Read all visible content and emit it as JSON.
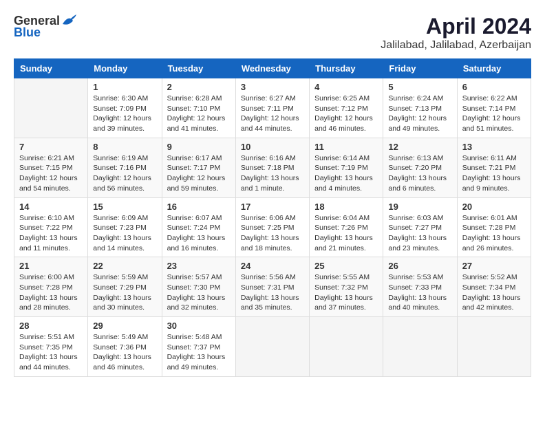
{
  "logo": {
    "text_general": "General",
    "text_blue": "Blue"
  },
  "title": {
    "month": "April 2024",
    "location": "Jalilabad, Jalilabad, Azerbaijan"
  },
  "headers": [
    "Sunday",
    "Monday",
    "Tuesday",
    "Wednesday",
    "Thursday",
    "Friday",
    "Saturday"
  ],
  "weeks": [
    [
      {
        "day": "",
        "info": ""
      },
      {
        "day": "1",
        "info": "Sunrise: 6:30 AM\nSunset: 7:09 PM\nDaylight: 12 hours\nand 39 minutes."
      },
      {
        "day": "2",
        "info": "Sunrise: 6:28 AM\nSunset: 7:10 PM\nDaylight: 12 hours\nand 41 minutes."
      },
      {
        "day": "3",
        "info": "Sunrise: 6:27 AM\nSunset: 7:11 PM\nDaylight: 12 hours\nand 44 minutes."
      },
      {
        "day": "4",
        "info": "Sunrise: 6:25 AM\nSunset: 7:12 PM\nDaylight: 12 hours\nand 46 minutes."
      },
      {
        "day": "5",
        "info": "Sunrise: 6:24 AM\nSunset: 7:13 PM\nDaylight: 12 hours\nand 49 minutes."
      },
      {
        "day": "6",
        "info": "Sunrise: 6:22 AM\nSunset: 7:14 PM\nDaylight: 12 hours\nand 51 minutes."
      }
    ],
    [
      {
        "day": "7",
        "info": "Sunrise: 6:21 AM\nSunset: 7:15 PM\nDaylight: 12 hours\nand 54 minutes."
      },
      {
        "day": "8",
        "info": "Sunrise: 6:19 AM\nSunset: 7:16 PM\nDaylight: 12 hours\nand 56 minutes."
      },
      {
        "day": "9",
        "info": "Sunrise: 6:17 AM\nSunset: 7:17 PM\nDaylight: 12 hours\nand 59 minutes."
      },
      {
        "day": "10",
        "info": "Sunrise: 6:16 AM\nSunset: 7:18 PM\nDaylight: 13 hours\nand 1 minute."
      },
      {
        "day": "11",
        "info": "Sunrise: 6:14 AM\nSunset: 7:19 PM\nDaylight: 13 hours\nand 4 minutes."
      },
      {
        "day": "12",
        "info": "Sunrise: 6:13 AM\nSunset: 7:20 PM\nDaylight: 13 hours\nand 6 minutes."
      },
      {
        "day": "13",
        "info": "Sunrise: 6:11 AM\nSunset: 7:21 PM\nDaylight: 13 hours\nand 9 minutes."
      }
    ],
    [
      {
        "day": "14",
        "info": "Sunrise: 6:10 AM\nSunset: 7:22 PM\nDaylight: 13 hours\nand 11 minutes."
      },
      {
        "day": "15",
        "info": "Sunrise: 6:09 AM\nSunset: 7:23 PM\nDaylight: 13 hours\nand 14 minutes."
      },
      {
        "day": "16",
        "info": "Sunrise: 6:07 AM\nSunset: 7:24 PM\nDaylight: 13 hours\nand 16 minutes."
      },
      {
        "day": "17",
        "info": "Sunrise: 6:06 AM\nSunset: 7:25 PM\nDaylight: 13 hours\nand 18 minutes."
      },
      {
        "day": "18",
        "info": "Sunrise: 6:04 AM\nSunset: 7:26 PM\nDaylight: 13 hours\nand 21 minutes."
      },
      {
        "day": "19",
        "info": "Sunrise: 6:03 AM\nSunset: 7:27 PM\nDaylight: 13 hours\nand 23 minutes."
      },
      {
        "day": "20",
        "info": "Sunrise: 6:01 AM\nSunset: 7:28 PM\nDaylight: 13 hours\nand 26 minutes."
      }
    ],
    [
      {
        "day": "21",
        "info": "Sunrise: 6:00 AM\nSunset: 7:28 PM\nDaylight: 13 hours\nand 28 minutes."
      },
      {
        "day": "22",
        "info": "Sunrise: 5:59 AM\nSunset: 7:29 PM\nDaylight: 13 hours\nand 30 minutes."
      },
      {
        "day": "23",
        "info": "Sunrise: 5:57 AM\nSunset: 7:30 PM\nDaylight: 13 hours\nand 32 minutes."
      },
      {
        "day": "24",
        "info": "Sunrise: 5:56 AM\nSunset: 7:31 PM\nDaylight: 13 hours\nand 35 minutes."
      },
      {
        "day": "25",
        "info": "Sunrise: 5:55 AM\nSunset: 7:32 PM\nDaylight: 13 hours\nand 37 minutes."
      },
      {
        "day": "26",
        "info": "Sunrise: 5:53 AM\nSunset: 7:33 PM\nDaylight: 13 hours\nand 40 minutes."
      },
      {
        "day": "27",
        "info": "Sunrise: 5:52 AM\nSunset: 7:34 PM\nDaylight: 13 hours\nand 42 minutes."
      }
    ],
    [
      {
        "day": "28",
        "info": "Sunrise: 5:51 AM\nSunset: 7:35 PM\nDaylight: 13 hours\nand 44 minutes."
      },
      {
        "day": "29",
        "info": "Sunrise: 5:49 AM\nSunset: 7:36 PM\nDaylight: 13 hours\nand 46 minutes."
      },
      {
        "day": "30",
        "info": "Sunrise: 5:48 AM\nSunset: 7:37 PM\nDaylight: 13 hours\nand 49 minutes."
      },
      {
        "day": "",
        "info": ""
      },
      {
        "day": "",
        "info": ""
      },
      {
        "day": "",
        "info": ""
      },
      {
        "day": "",
        "info": ""
      }
    ]
  ]
}
